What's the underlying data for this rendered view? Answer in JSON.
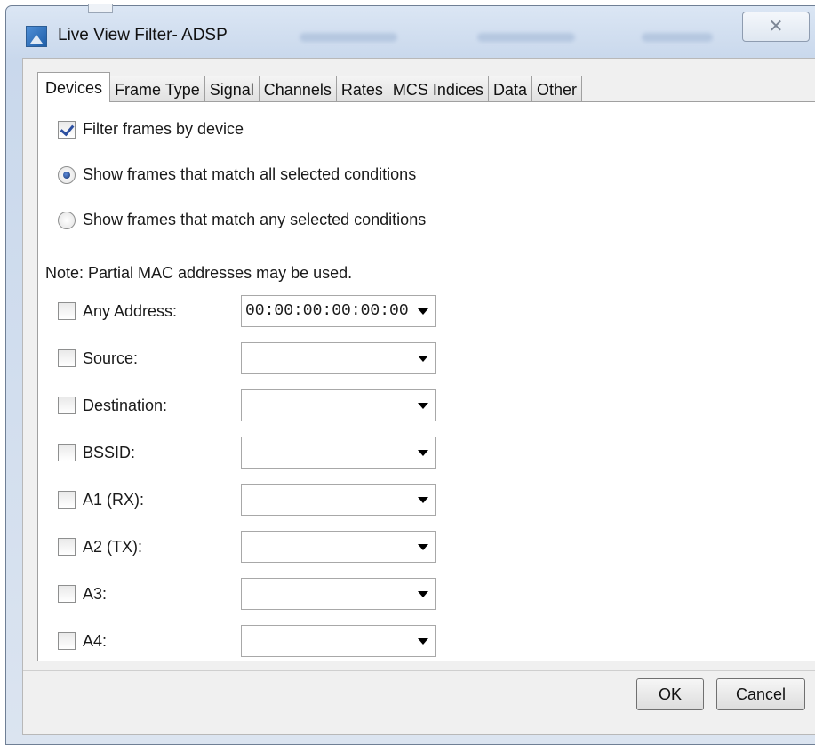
{
  "window": {
    "title": "Live View Filter- ADSP",
    "close_glyph": "✕"
  },
  "tabs": [
    {
      "label": "Devices"
    },
    {
      "label": "Frame Type"
    },
    {
      "label": "Signal"
    },
    {
      "label": "Channels"
    },
    {
      "label": "Rates"
    },
    {
      "label": "MCS Indices"
    },
    {
      "label": "Data"
    },
    {
      "label": "Other"
    }
  ],
  "active_tab": "Devices",
  "filter_by_device": {
    "label": "Filter frames by device",
    "checked": true
  },
  "match_mode": {
    "all_label": "Show frames that match all selected conditions",
    "any_label": "Show frames that match any selected conditions",
    "selected": "all"
  },
  "note": "Note: Partial MAC addresses may be used.",
  "address_fields": [
    {
      "label": "Any Address:",
      "value": "00:00:00:00:00:00",
      "checked": false
    },
    {
      "label": "Source:",
      "value": "",
      "checked": false
    },
    {
      "label": "Destination:",
      "value": "",
      "checked": false
    },
    {
      "label": "BSSID:",
      "value": "",
      "checked": false
    },
    {
      "label": "A1 (RX):",
      "value": "",
      "checked": false
    },
    {
      "label": "A2 (TX):",
      "value": "",
      "checked": false
    },
    {
      "label": "A3:",
      "value": "",
      "checked": false
    },
    {
      "label": "A4:",
      "value": "",
      "checked": false
    }
  ],
  "buttons": {
    "ok": "OK",
    "cancel": "Cancel"
  },
  "icons": {
    "app": "app-icon",
    "close": "close-icon",
    "dropdown": "chevron-down-icon"
  }
}
